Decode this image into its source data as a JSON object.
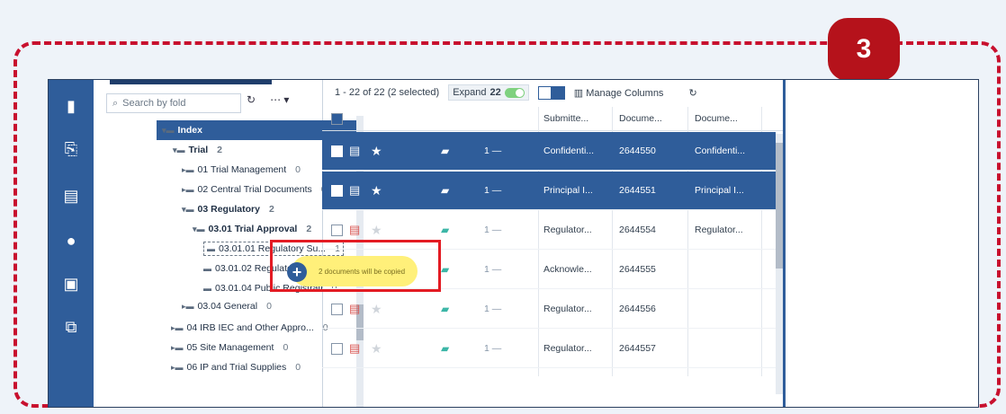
{
  "step_badge": "3",
  "search": {
    "placeholder": "Search by fold"
  },
  "tree": {
    "nodes": [
      {
        "label": "Index",
        "count": ""
      },
      {
        "label": "Trial",
        "count": "2"
      },
      {
        "label": "01 Trial Management",
        "count": "0"
      },
      {
        "label": "02 Central Trial Documents",
        "count": "0"
      },
      {
        "label": "03 Regulatory",
        "count": "2"
      },
      {
        "label": "03.01 Trial Approval",
        "count": "2"
      },
      {
        "label": "03.01.01 Regulatory Su...",
        "count": "1"
      },
      {
        "label": "03.01.02 Regulatory Au...",
        "count": ""
      },
      {
        "label": "03.01.04 Public Registrati",
        "count": "0"
      },
      {
        "label": "03.04 General",
        "count": "0"
      },
      {
        "label": "04 IRB IEC and Other Appro...",
        "count": "0"
      },
      {
        "label": "05 Site Management",
        "count": "0"
      },
      {
        "label": "06 IP and Trial Supplies",
        "count": "0"
      }
    ]
  },
  "grid": {
    "summary": "1 - 22 of 22 (2 selected)",
    "expand_label": "Expand",
    "expand_count": "22",
    "manage_columns": "Manage Columns",
    "columns": [
      "Submitte...",
      "Docume...",
      "Docume..."
    ],
    "rows": [
      {
        "selected": true,
        "c1": "Confidenti...",
        "c2": "2644550",
        "c3": "Confidenti..."
      },
      {
        "selected": true,
        "c1": "Principal I...",
        "c2": "2644551",
        "c3": "Principal I..."
      },
      {
        "selected": false,
        "c1": "Regulator...",
        "c2": "2644554",
        "c3": "Regulator..."
      },
      {
        "selected": false,
        "c1": "Acknowle...",
        "c2": "2644555",
        "c3": ""
      },
      {
        "selected": false,
        "c1": "Regulator...",
        "c2": "2644556",
        "c3": ""
      },
      {
        "selected": false,
        "c1": "Regulator...",
        "c2": "2644557",
        "c3": ""
      }
    ]
  },
  "tooltip": "2 documents will be copied",
  "colors": {
    "accent": "#2f5d9a",
    "highlight": "#e31b23",
    "badge": "#b5121b"
  }
}
